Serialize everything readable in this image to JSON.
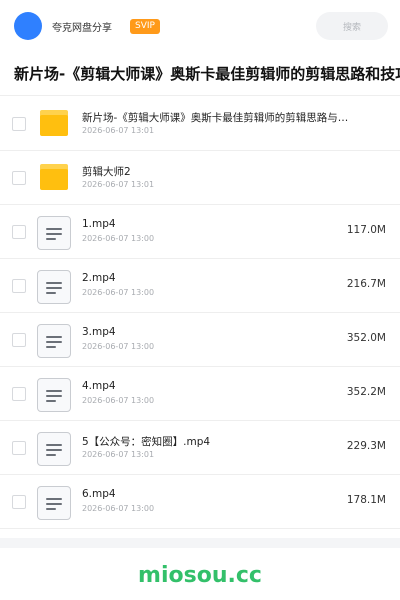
{
  "header": {
    "app_name": "夸克网盘分享",
    "badge": "SVIP",
    "search_placeholder": "搜索"
  },
  "page_title": "新片场-《剪辑大师课》奥斯卡最佳剪辑师的剪辑思路和技巧",
  "items": [
    {
      "type": "folder",
      "name": "新片场-《剪辑大师课》奥斯卡最佳剪辑师的剪辑思路与…",
      "date": "2026-06-07 13:01",
      "size": ""
    },
    {
      "type": "folder",
      "name": "剪辑大师2",
      "date": "2026-06-07 13:01",
      "size": ""
    },
    {
      "type": "file",
      "name": "1.mp4",
      "date": "2026-06-07 13:00",
      "size": "117.0M"
    },
    {
      "type": "file",
      "name": "2.mp4",
      "date": "2026-06-07 13:00",
      "size": "216.7M"
    },
    {
      "type": "file",
      "name": "3.mp4",
      "date": "2026-06-07 13:00",
      "size": "352.0M"
    },
    {
      "type": "file",
      "name": "4.mp4",
      "date": "2026-06-07 13:00",
      "size": "352.2M"
    },
    {
      "type": "file",
      "name": "5【公众号：密知圈】.mp4",
      "date": "2026-06-07 13:01",
      "size": "229.3M"
    },
    {
      "type": "file",
      "name": "6.mp4",
      "date": "2026-06-07 13:00",
      "size": "178.1M"
    }
  ],
  "watermark": "miosou.cc",
  "colors": {
    "avatar": "#2f80ff",
    "badge": "#ff9a1a",
    "folder": "#ffbf0f",
    "watermark": "#33c06a"
  }
}
